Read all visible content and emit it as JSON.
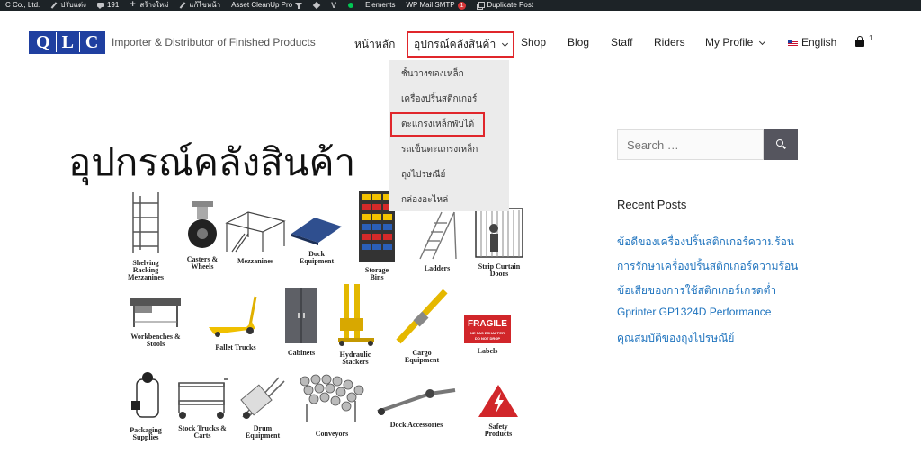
{
  "adminbar": {
    "site_name": "C Co., Ltd.",
    "customize": "ปรับแต่ง",
    "comments_count": "191",
    "new_label": "สร้างใหม่",
    "edit_page": "แก้ไขหน้า",
    "asset_cleanup": "Asset CleanUp Pro",
    "elements": "Elements",
    "wp_mail_smtp": "WP Mail SMTP",
    "smtp_badge": "1",
    "duplicate_post": "Duplicate Post"
  },
  "header": {
    "logo": [
      "Q",
      "L",
      "C"
    ],
    "tagline": "Importer & Distributor of Finished Products",
    "nav": {
      "home": "หน้าหลัก",
      "equipment": "อุปกรณ์คลังสินค้า",
      "shop": "Shop",
      "blog": "Blog",
      "staff": "Staff",
      "riders": "Riders",
      "my_profile": "My Profile",
      "language": "English"
    },
    "cart_count": "1"
  },
  "dropdown": {
    "items": [
      "ชั้นวางของเหล็ก",
      "เครื่องปริ้นสติกเกอร์",
      "ตะแกรงเหล็กพับได้",
      "รถเข็นตะแกรงเหล็ก",
      "ถุงไปรษณีย์",
      "กล่องอะไหล่"
    ]
  },
  "main": {
    "title": "อุปกรณ์คลังสินค้า",
    "catalog": [
      "Shelving Racking Mezzanines",
      "Casters & Wheels",
      "Mezzanines",
      "Dock Equipment",
      "Storage Bins",
      "Ladders",
      "Strip Curtain Doors",
      "Workbenches & Stools",
      "Pallet Trucks",
      "Cabinets",
      "Hydraulic Stackers",
      "Cargo Equipment",
      "Labels",
      "Packaging Supplies",
      "Stock Trucks & Carts",
      "Drum Equipment",
      "Conveyors",
      "Dock Accessories",
      "Safety Products"
    ],
    "fragile_text": "FRAGILE",
    "fragile_sub1": "NE PAS ECHAPPER",
    "fragile_sub2": "DO NOT DROP"
  },
  "sidebar": {
    "search_placeholder": "Search …",
    "recent_posts_title": "Recent Posts",
    "recent_posts": [
      "ข้อดีของเครื่องปริ้นสติกเกอร์ความร้อน",
      "การรักษาเครื่องปริ้นสติกเกอร์ความร้อน",
      "ข้อเสียของการใช้สติกเกอร์เกรดต่ำ",
      "Gprinter GP1324D Performance",
      "คุณสมบัติของถุงไปรษณีย์"
    ]
  }
}
